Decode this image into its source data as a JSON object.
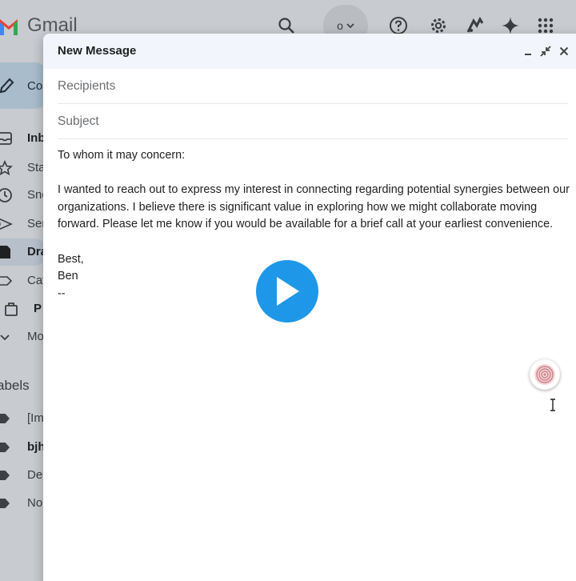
{
  "app": {
    "brand": "Gmail",
    "account_chip_letter": "o",
    "compose_label": "Co"
  },
  "topbar_icons": [
    "search-icon",
    "help-icon",
    "settings-icon",
    "extension-icon",
    "gemini-sparkle-icon",
    "apps-grid-icon"
  ],
  "sidebar": {
    "items": [
      {
        "label": "Inb",
        "icon": "inbox-icon",
        "bold": true
      },
      {
        "label": "Sta",
        "icon": "star-icon",
        "bold": false
      },
      {
        "label": "Sno",
        "icon": "clock-icon",
        "bold": false
      },
      {
        "label": "Ser",
        "icon": "send-icon",
        "bold": false
      },
      {
        "label": "Dra",
        "icon": "draft-icon",
        "bold": true
      },
      {
        "label": "Cat",
        "icon": "label-outline-icon",
        "bold": false
      },
      {
        "label": "P",
        "icon": "bag-icon",
        "bold": true
      },
      {
        "label": "Mo",
        "icon": "chevron-down-icon",
        "bold": false
      }
    ],
    "labels_heading": "abels",
    "labels": [
      {
        "label": "[Im",
        "bold": false
      },
      {
        "label": "bjh",
        "bold": true
      },
      {
        "label": "De",
        "bold": false
      },
      {
        "label": "No",
        "bold": false
      }
    ]
  },
  "compose": {
    "title": "New Message",
    "recipients_placeholder": "Recipients",
    "subject_placeholder": "Subject",
    "body": {
      "greeting": "To whom it may concern:",
      "paragraph": "I wanted to reach out to express my interest in connecting regarding potential synergies between our organizations. I believe there is significant value in exploring how we might collaborate moving forward. Please let me know if you would be available for a brief call at your earliest convenience.",
      "signoff": "Best,",
      "name": "Ben",
      "signature_sep": "--"
    }
  },
  "colors": {
    "play_button": "#1e97e8",
    "compose_header": "#f2f6fc",
    "backdrop": "#c8cbcf"
  }
}
